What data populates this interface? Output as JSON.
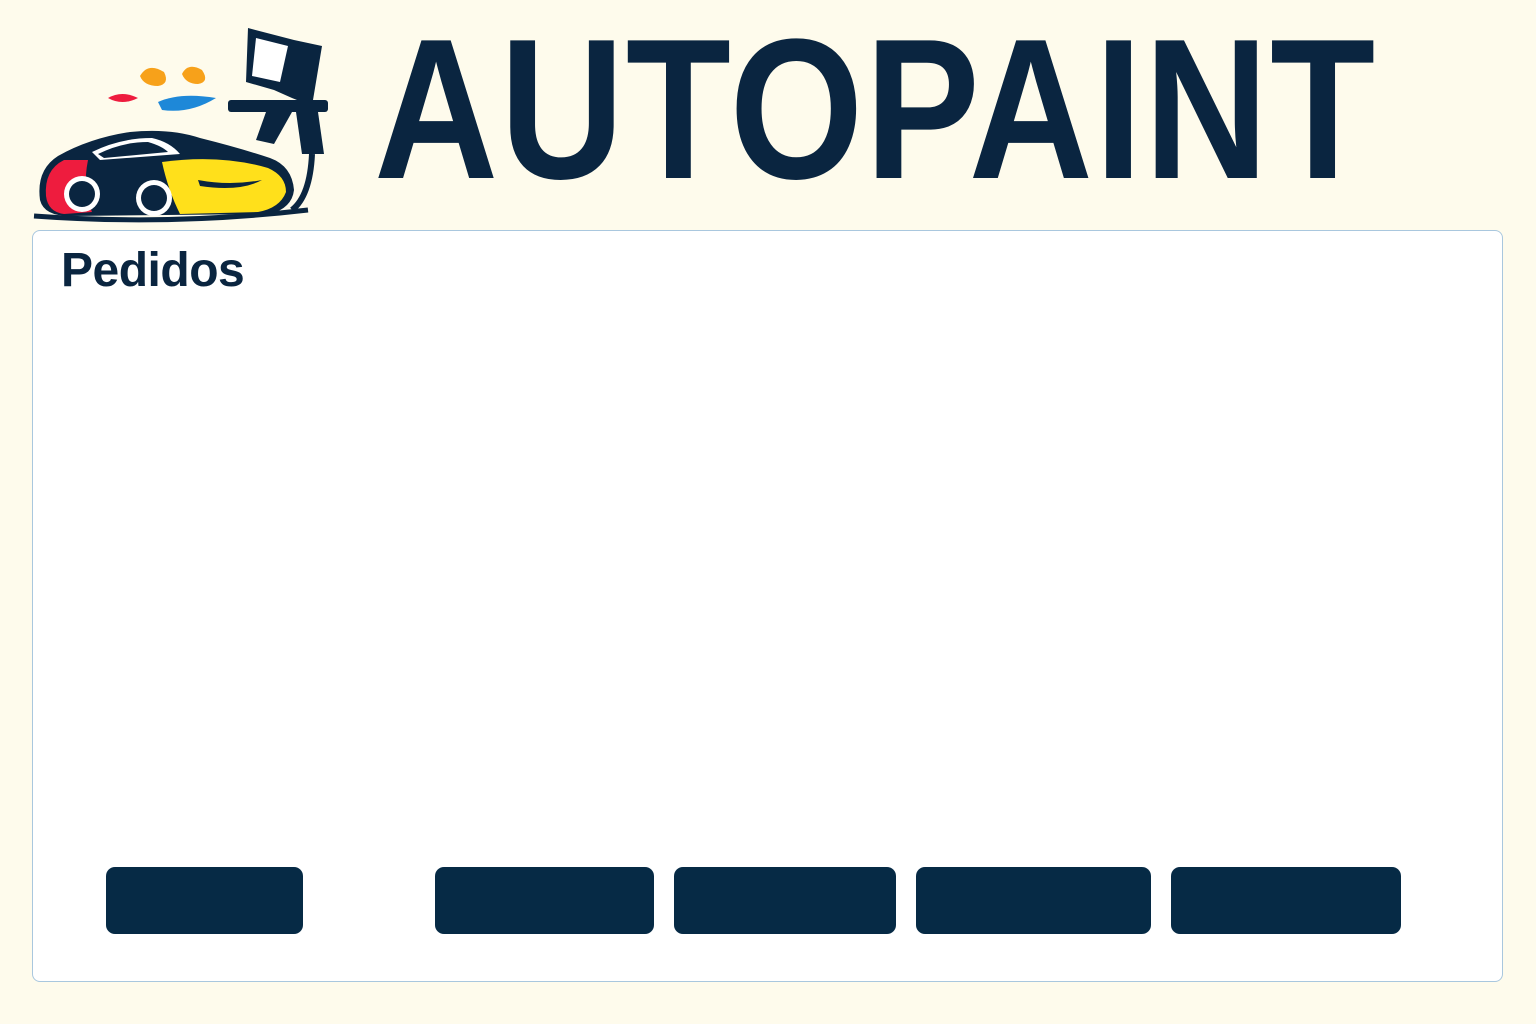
{
  "app": {
    "brand_name": "AUTOPAINT",
    "logo_icon": "car-spray-gun-logo",
    "colors": {
      "background": "#fefbec",
      "primary": "#0a2540",
      "button": "#062a45",
      "panel_border": "#a9c7de",
      "paint_red": "#ee1c3e",
      "paint_yellow": "#ffe01b",
      "paint_orange": "#f7a11a",
      "paint_blue": "#1e88d8"
    }
  },
  "panel": {
    "title": "Pedidos"
  },
  "actions": [
    {
      "label": ""
    },
    {
      "label": ""
    },
    {
      "label": ""
    },
    {
      "label": ""
    },
    {
      "label": ""
    }
  ]
}
